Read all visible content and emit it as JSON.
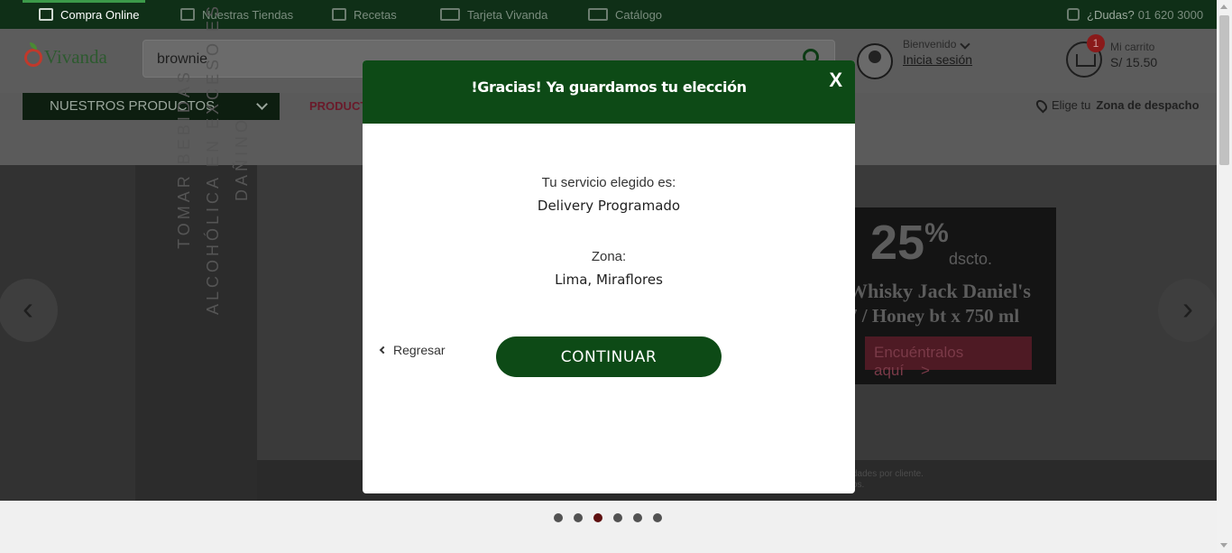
{
  "topbar": {
    "items": [
      {
        "label": "Compra Online",
        "icon": "bag-icon"
      },
      {
        "label": "Nuestras Tiendas",
        "icon": "store-icon"
      },
      {
        "label": "Recetas",
        "icon": "recipe-icon"
      },
      {
        "label": "Tarjeta Vivanda",
        "icon": "card-icon"
      },
      {
        "label": "Catálogo",
        "icon": "book-icon"
      }
    ],
    "phone_label": "¿Dudas?",
    "phone_number": "01 620 3000"
  },
  "header": {
    "logo_text": "Vivanda",
    "search_value": "brownie",
    "welcome": "Bienvenido",
    "login": "Inicia sesión",
    "cart_count": "1",
    "cart_label": "Mi carrito",
    "cart_total": "S/ 15.50"
  },
  "catbar": {
    "products_button": "NUESTROS PRODUCTOS",
    "promo_link": "PRODUCTO",
    "zone_prefix": "Elige tu",
    "zone_bold": "Zona de despacho"
  },
  "banner": {
    "warning": "TOMAR BEBIDAS ALCOHÓLICA EN EXCESO ES DAÑINO",
    "promo_pct": "25",
    "promo_sup": "%",
    "promo_dsct": "dscto.",
    "promo_line1": "Whisky Jack Daniel's",
    "promo_line2": "7 / Honey bt x 750 ml",
    "promo_cta": "Encuéntralos aquí",
    "legal_line1": "dades por cliente.",
    "legal_line2": "os.",
    "active_slide": 3,
    "slide_count": 6
  },
  "modal": {
    "title": "!Gracias! Ya guardamos tu elección",
    "close": "X",
    "service_label": "Tu servicio elegido es:",
    "service_value": "Delivery Programado",
    "zone_label": "Zona:",
    "zone_value": "Lima, Miraflores",
    "back": "Regresar",
    "continue": "CONTINUAR"
  },
  "colors": {
    "brand_green": "#0d4a16",
    "topbar": "#0f2f17"
  }
}
